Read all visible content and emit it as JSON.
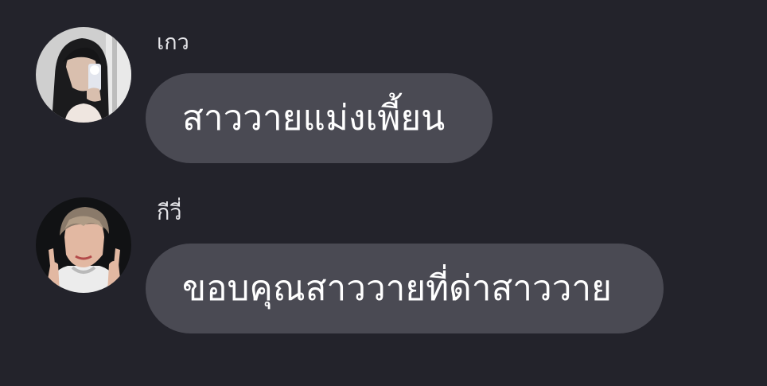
{
  "theme": {
    "background": "#23232b",
    "bubble": "#4a4a53",
    "text": "#ffffff",
    "sender_text": "#e6e6ea"
  },
  "messages": [
    {
      "sender": "เกว",
      "text": "สาววายแม่งเพี้ยน",
      "avatar_icon": "user-photo-avatar"
    },
    {
      "sender": "กีวี่",
      "text": "ขอบคุณสาววายที่ด่าสาววาย",
      "avatar_icon": "user-photo-avatar"
    }
  ]
}
